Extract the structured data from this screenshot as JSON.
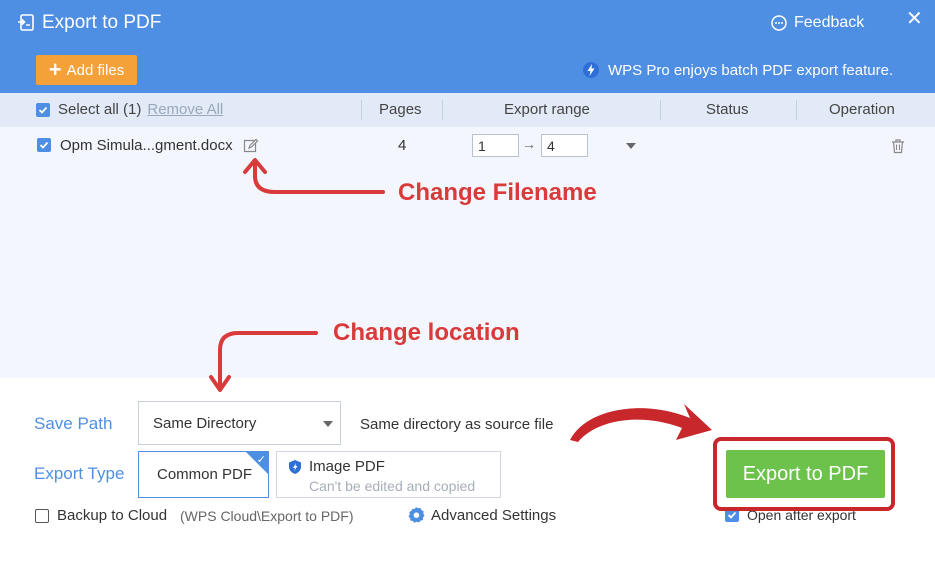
{
  "window": {
    "title": "Export to PDF",
    "feedback_label": "Feedback",
    "close_symbol": "✕"
  },
  "toolbar": {
    "add_files_label": "Add files",
    "promo_text": "WPS Pro enjoys batch PDF export feature."
  },
  "table": {
    "select_all_label": "Select all (1)",
    "remove_all_label": "Remove All",
    "columns": [
      "Pages",
      "Export range",
      "Status",
      "Operation"
    ],
    "rows": [
      {
        "filename": "Opm Simula...gment.docx",
        "pages": "4",
        "range_from": "1",
        "range_to": "4",
        "arrow": "→"
      }
    ]
  },
  "annotations": {
    "change_filename": "Change Filename",
    "change_location": "Change location",
    "color": "#d93a3a"
  },
  "settings": {
    "save_path_label": "Save Path",
    "save_path_value": "Same Directory",
    "save_path_note": "Same directory as source file",
    "export_type_label": "Export Type",
    "type_common": "Common PDF",
    "type_image": "Image PDF",
    "type_image_note": "Can't be edited and copied",
    "backup_label": "Backup to Cloud",
    "cloud_path": "(WPS Cloud\\Export to PDF)",
    "advanced_label": "Advanced Settings",
    "open_after_label": "Open after export",
    "export_button_label": "Export to PDF"
  },
  "colors": {
    "header_blue": "#4f8fe3",
    "add_files_orange": "#f5a13a",
    "export_green": "#6cc24a",
    "highlight_red": "#c8272b"
  }
}
